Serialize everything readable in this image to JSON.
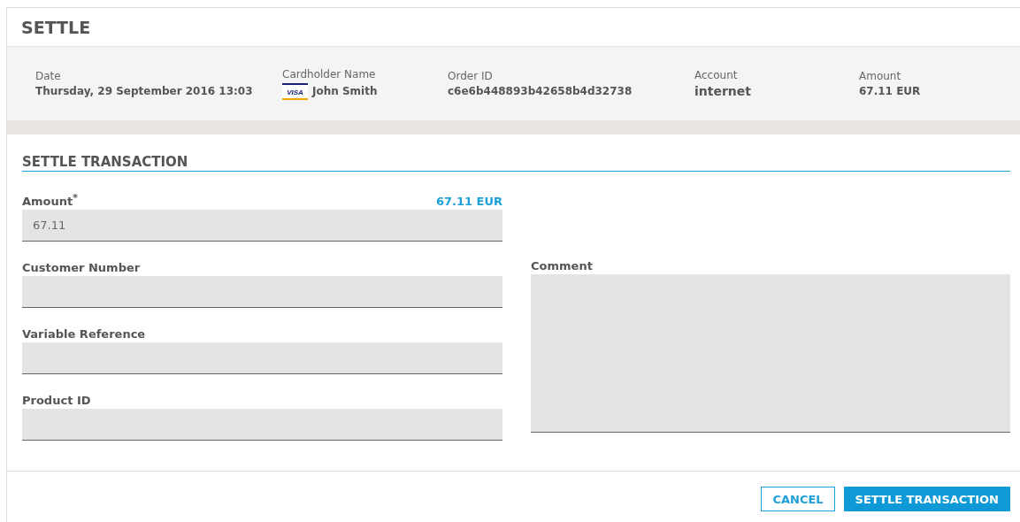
{
  "title": "SETTLE",
  "info": [
    {
      "label": "Date",
      "value": "Thursday, 29 September 2016 13:03"
    },
    {
      "label": "Cardholder Name",
      "value": "John Smith",
      "card": "VISA"
    },
    {
      "label": "Order ID",
      "value": "c6e6b448893b42658b4d32738"
    },
    {
      "label": "Account",
      "value": "internet",
      "large": true
    },
    {
      "label": "Amount",
      "value": "67.11 EUR"
    }
  ],
  "section": "SETTLE TRANSACTION",
  "amount": {
    "label": "Amount$^{*}$",
    "hint": "67.11 EUR",
    "value": "67.11"
  },
  "fields": [
    {
      "label": "Customer Number"
    },
    {
      "label": "Variable Reference"
    },
    {
      "label": "Product ID"
    }
  ],
  "comment": {
    "label": "Comment"
  },
  "buttons": [
    {
      "label": "CANCEL",
      "kind": "secondary"
    },
    {
      "label": "SETTLE TRANSACTION",
      "kind": "primary"
    }
  ]
}
